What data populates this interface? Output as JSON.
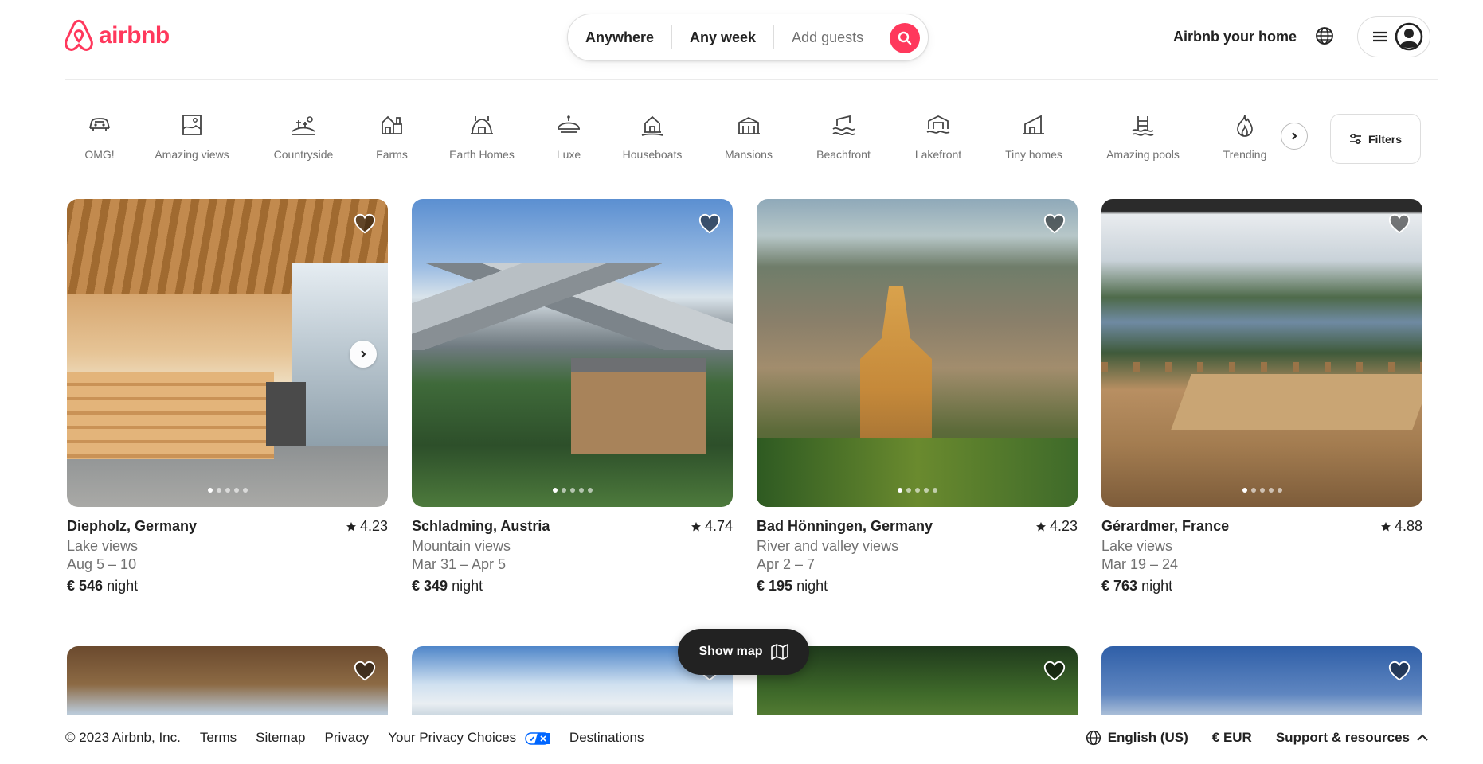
{
  "brand": {
    "name": "airbnb",
    "color": "#FF385C"
  },
  "search": {
    "where": "Anywhere",
    "when": "Any week",
    "who": "Add guests",
    "icon": "search-icon"
  },
  "header": {
    "host_link": "Airbnb your home",
    "globe_icon": "globe-icon",
    "menu_icon": "menu-icon",
    "avatar_icon": "avatar-icon"
  },
  "categories": [
    {
      "label": "OMG!",
      "icon": "omg-icon"
    },
    {
      "label": "Amazing views",
      "icon": "views-icon"
    },
    {
      "label": "Countryside",
      "icon": "countryside-icon"
    },
    {
      "label": "Farms",
      "icon": "farms-icon"
    },
    {
      "label": "Earth Homes",
      "icon": "earth-homes-icon"
    },
    {
      "label": "Luxe",
      "icon": "luxe-icon"
    },
    {
      "label": "Houseboats",
      "icon": "houseboats-icon"
    },
    {
      "label": "Mansions",
      "icon": "mansions-icon"
    },
    {
      "label": "Beachfront",
      "icon": "beachfront-icon"
    },
    {
      "label": "Lakefront",
      "icon": "lakefront-icon"
    },
    {
      "label": "Tiny homes",
      "icon": "tiny-homes-icon"
    },
    {
      "label": "Amazing pools",
      "icon": "pools-icon"
    },
    {
      "label": "Trending",
      "icon": "trending-icon"
    }
  ],
  "filters_label": "Filters",
  "listings": [
    {
      "location": "Diepholz, Germany",
      "rating": "4.23",
      "subtitle": "Lake views",
      "dates": "Aug 5 – 10",
      "price": "€ 546",
      "price_unit": "night"
    },
    {
      "location": "Schladming, Austria",
      "rating": "4.74",
      "subtitle": "Mountain views",
      "dates": "Mar 31 – Apr 5",
      "price": "€ 349",
      "price_unit": "night"
    },
    {
      "location": "Bad Hönningen, Germany",
      "rating": "4.23",
      "subtitle": "River and valley views",
      "dates": "Apr 2 – 7",
      "price": "€ 195",
      "price_unit": "night"
    },
    {
      "location": "Gérardmer, France",
      "rating": "4.88",
      "subtitle": "Lake views",
      "dates": "Mar 19 – 24",
      "price": "€ 763",
      "price_unit": "night"
    }
  ],
  "show_map": "Show map",
  "footer": {
    "copyright": "© 2023 Airbnb, Inc.",
    "links": [
      "Terms",
      "Sitemap",
      "Privacy",
      "Your Privacy Choices",
      "Destinations"
    ],
    "language": "English (US)",
    "currency": "€ EUR",
    "support": "Support & resources"
  }
}
